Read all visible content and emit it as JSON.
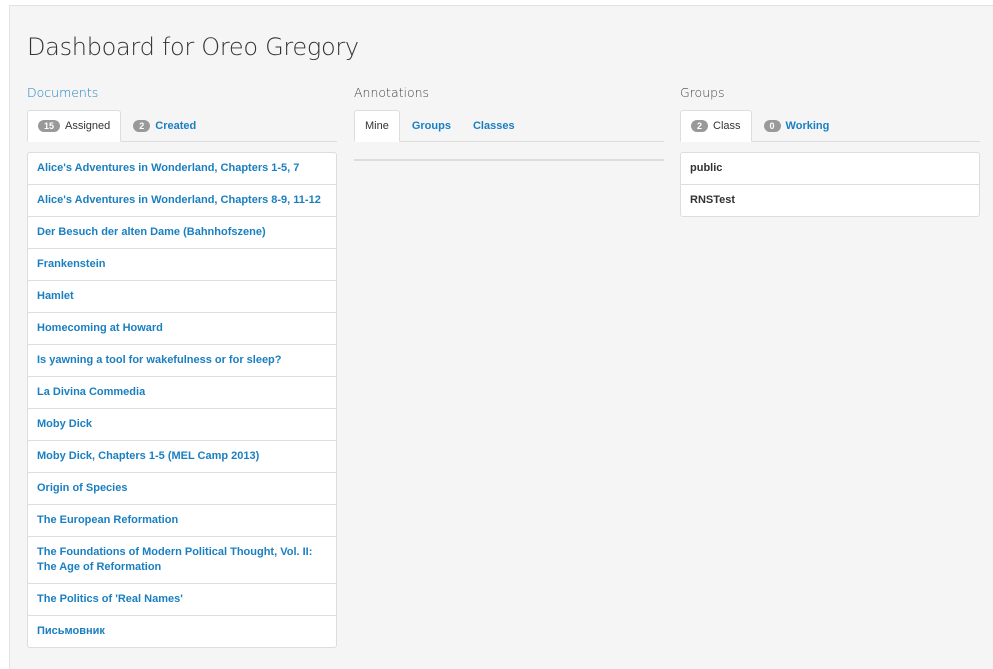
{
  "page_title": "Dashboard for Oreo Gregory",
  "documents": {
    "heading": "Documents",
    "tabs": [
      {
        "badge": "15",
        "label": "Assigned"
      },
      {
        "badge": "2",
        "label": "Created"
      }
    ],
    "items": [
      "Alice's Adventures in Wonderland, Chapters 1-5, 7",
      "Alice's Adventures in Wonderland, Chapters 8-9, 11-12",
      "Der Besuch der alten Dame (Bahnhofszene)",
      "Frankenstein",
      "Hamlet",
      "Homecoming at Howard",
      "Is yawning a tool for wakefulness or for sleep?",
      "La Divina Commedia",
      "Moby Dick",
      "Moby Dick, Chapters 1-5 (MEL Camp 2013)",
      "Origin of Species",
      "The European Reformation",
      "The Foundations of Modern Political Thought, Vol. II: The Age of Reformation",
      "The Politics of 'Real Names'",
      "Письмовник"
    ]
  },
  "annotations": {
    "heading": "Annotations",
    "tabs": [
      {
        "label": "Mine"
      },
      {
        "label": "Groups"
      },
      {
        "label": "Classes"
      }
    ]
  },
  "groups": {
    "heading": "Groups",
    "tabs": [
      {
        "badge": "2",
        "label": "Class"
      },
      {
        "badge": "0",
        "label": "Working"
      }
    ],
    "items": [
      "public",
      "RNSTest"
    ]
  },
  "colors": {
    "link": "#1a7fc1",
    "badge": "#999999",
    "panel_background": "#f5f5f5"
  }
}
